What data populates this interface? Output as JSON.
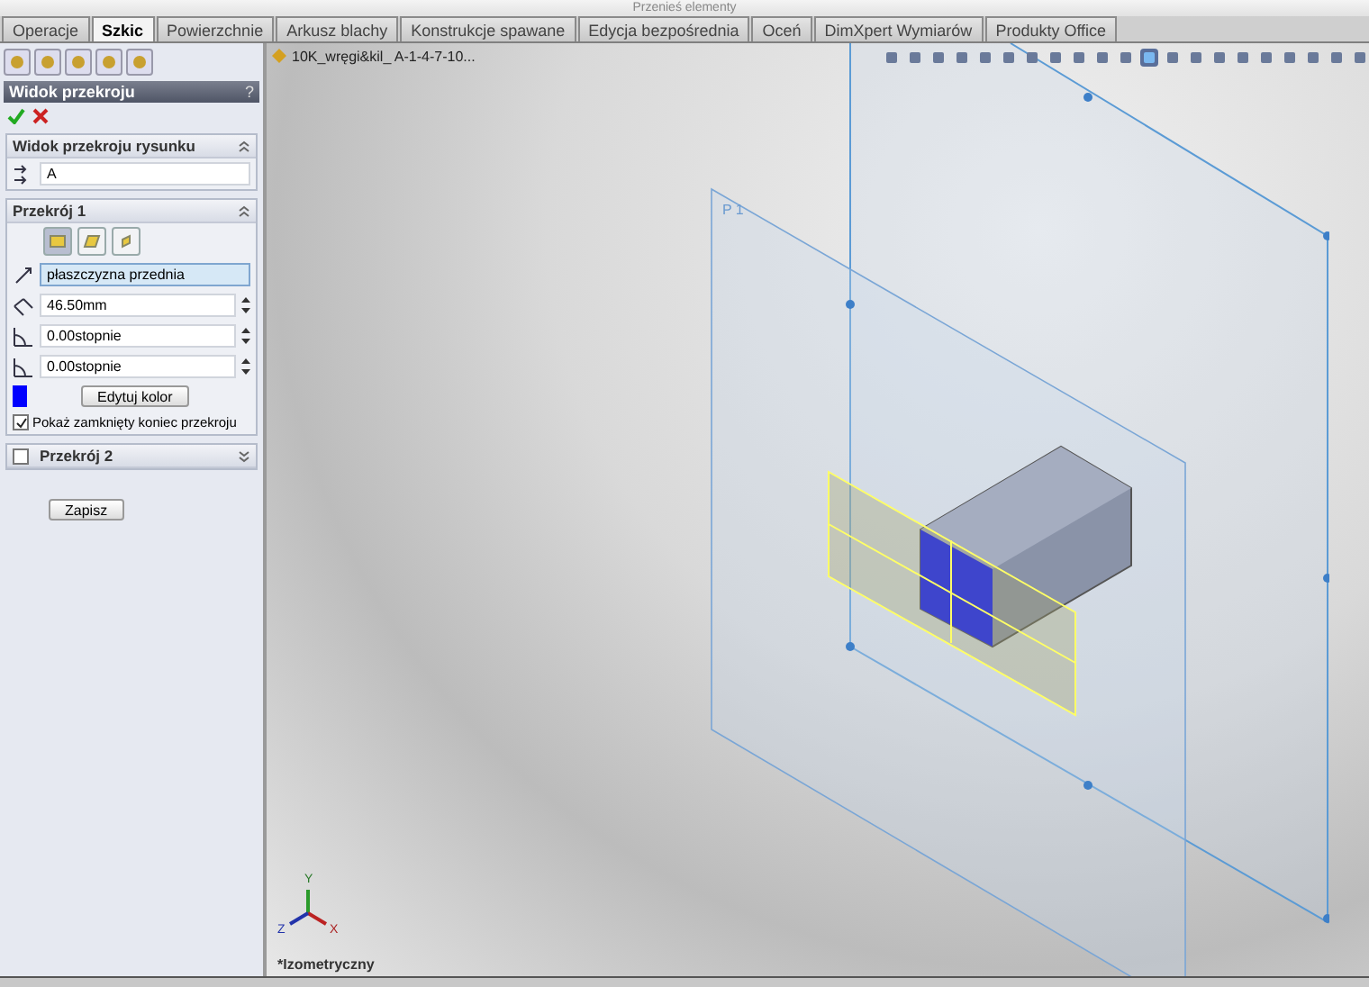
{
  "toolbar": {
    "command": "Przenieś elementy"
  },
  "tabs": [
    {
      "label": "Operacje",
      "selected": false
    },
    {
      "label": "Szkic",
      "selected": true
    },
    {
      "label": "Powierzchnie",
      "selected": false
    },
    {
      "label": "Arkusz blachy",
      "selected": false
    },
    {
      "label": "Konstrukcje spawane",
      "selected": false
    },
    {
      "label": "Edycja bezpośrednia",
      "selected": false
    },
    {
      "label": "Oceń",
      "selected": false
    },
    {
      "label": "DimXpert Wymiarów",
      "selected": false
    },
    {
      "label": "Produkty Office",
      "selected": false
    }
  ],
  "property_manager": {
    "title": "Widok przekroju",
    "help": "?"
  },
  "drawing_view_section": {
    "title": "Widok przekroju rysunku",
    "name_value": "A"
  },
  "section1": {
    "title": "Przekrój 1",
    "plane_modes": [
      {
        "selected": true
      },
      {
        "selected": false
      },
      {
        "selected": false
      }
    ],
    "plane": "płaszczyzna przednia",
    "offset": "46.50mm",
    "angle_x": "0.00stopnie",
    "angle_y": "0.00stopnie",
    "color": "#0000ff",
    "color_button": "Edytuj kolor",
    "show_closed_end": {
      "label": "Pokaż zamknięty koniec przekroju",
      "checked": true
    }
  },
  "section2": {
    "title": "Przekrój 2",
    "checked": false
  },
  "save_button": "Zapisz",
  "viewport": {
    "tree_item": "10K_wręgi&kil_ A-1-4-7-10...",
    "plane_label": "P 1",
    "view_name": "*Izometryczny",
    "triad": {
      "y": "Y",
      "x": "X",
      "z": "Z"
    }
  }
}
